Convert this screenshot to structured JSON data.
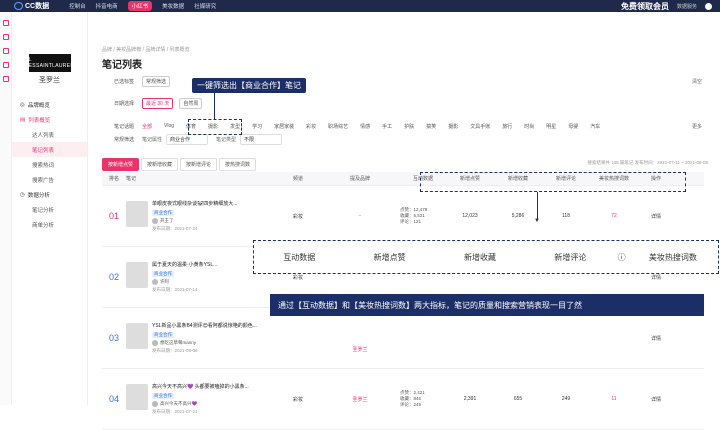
{
  "topbar": {
    "logo": "CC数据",
    "nav": [
      "控制台",
      "抖音电商",
      "小红书",
      "美妆数据",
      "社媒研究"
    ],
    "active": "小红书",
    "vip": "免费领取会员",
    "right_link": "数据服务"
  },
  "sidebar": {
    "brand_logo": "YSL YVESSAINTLAURENT",
    "brand_name": "圣罗兰",
    "items": [
      {
        "label": "品牌概览",
        "type": "parent",
        "active": false
      },
      {
        "label": "列表概览",
        "type": "parent",
        "active": false
      },
      {
        "label": "达人列表",
        "type": "sub",
        "active": false
      },
      {
        "label": "笔记列表",
        "type": "sub",
        "active": true
      },
      {
        "label": "搜索热词",
        "type": "sub",
        "active": false
      },
      {
        "label": "搜索广告",
        "type": "sub",
        "active": false
      },
      {
        "label": "数据分析",
        "type": "parent",
        "active": false
      },
      {
        "label": "笔记分析",
        "type": "sub",
        "active": false
      },
      {
        "label": "商单分析",
        "type": "sub",
        "active": false
      }
    ]
  },
  "main": {
    "breadcrumb": "品牌 / 美妆品牌榜 / 品牌详情 / 列表概览",
    "title": "笔记列表",
    "filters": {
      "label1": "已选标签",
      "tag_common": "常规筛选",
      "clear": "清空",
      "label2": "日期选择",
      "date_sel": "最近 30 天",
      "date_custom": "自然周",
      "label3": "笔记话题",
      "topics": [
        "全部",
        "Vlog",
        "体育",
        "摄影",
        "发型",
        "学习",
        "家居家装",
        "彩妆",
        "职场综艺",
        "情感",
        "手工",
        "护肤",
        "搞笑",
        "摄影",
        "文具手账",
        "旅行",
        "时尚",
        "明星",
        "母婴",
        "汽车"
      ],
      "more": "更多",
      "label4": "常规筛选",
      "note_attr": "笔记属性",
      "note_attr_val": "商业合作",
      "note_type": "笔记类型",
      "note_type_val": "不限"
    },
    "tabs": [
      "按新增点赞",
      "按新增收藏",
      "按新增评论",
      "按热搜词数"
    ],
    "meta": "搜索结果共 105 篇笔记   发布时间：2021-07-11 ~ 2021-08-09",
    "columns": [
      "排名",
      "笔记",
      "频道",
      "提及品牌",
      "互动数据",
      "新增点赞",
      "新增收藏",
      "新增评论",
      "美妆热搜词数",
      "操作"
    ],
    "rows": [
      {
        "rank": "01",
        "title": "单眼皮夜式眼线杂谈🐼四步精细放大...",
        "badge": "商业合作",
        "author": "开王了",
        "date": "发布日期：2021-07-24",
        "channel": "彩妆",
        "brand": "-",
        "interact": [
          "点赞：12,478",
          "收藏：5,531",
          "评论：121"
        ],
        "likes": "12,023",
        "favs": "5,286",
        "comments": "118",
        "hot": "72",
        "op": "详情"
      },
      {
        "rank": "02",
        "title": "属于夏天的温柔·小黄条YSL...",
        "badge": "商业合作",
        "author": "许阿",
        "date": "发布日期：2021-07-14",
        "channel": "彩妆",
        "brand": "",
        "interact": [
          "",
          "",
          ""
        ],
        "likes": "",
        "favs": "",
        "comments": "",
        "hot": "",
        "op": "详情"
      },
      {
        "rank": "03",
        "title": "YSL新品小黑条B4测评😍看阿都说惊艳的颜色...",
        "badge": "商业合作",
        "author": "想吃这草莓manny",
        "date": "发布日期：2021-08-06",
        "channel": "",
        "brand": "圣罗兰",
        "interact": [
          "",
          "",
          ""
        ],
        "likes": "",
        "favs": "",
        "comments": "",
        "hot": "",
        "op": "详情"
      },
      {
        "rank": "04",
        "title": "高兴今天不高兴💜 头都要被嗑掉的小黑条...",
        "badge": "商业合作",
        "author": "高兴今天不高兴💜",
        "date": "发布日期：2021-07-21",
        "channel": "彩妆",
        "brand": "圣罗兰",
        "interact": [
          "点赞：2,421",
          "收藏：846",
          "评论：249"
        ],
        "likes": "2,391",
        "favs": "655",
        "comments": "249",
        "hot": "11",
        "op": "详情"
      }
    ]
  },
  "callouts": {
    "c1": "一键筛选出【商业合作】笔记",
    "zoom": [
      "互动数据",
      "新增点赞",
      "新增收藏",
      "新增评论",
      "美妆热搜词数"
    ],
    "c2": "通过【互动数据】和【美妆热搜词数】两大指标，笔记的质量和搜索营销表现一目了然"
  }
}
